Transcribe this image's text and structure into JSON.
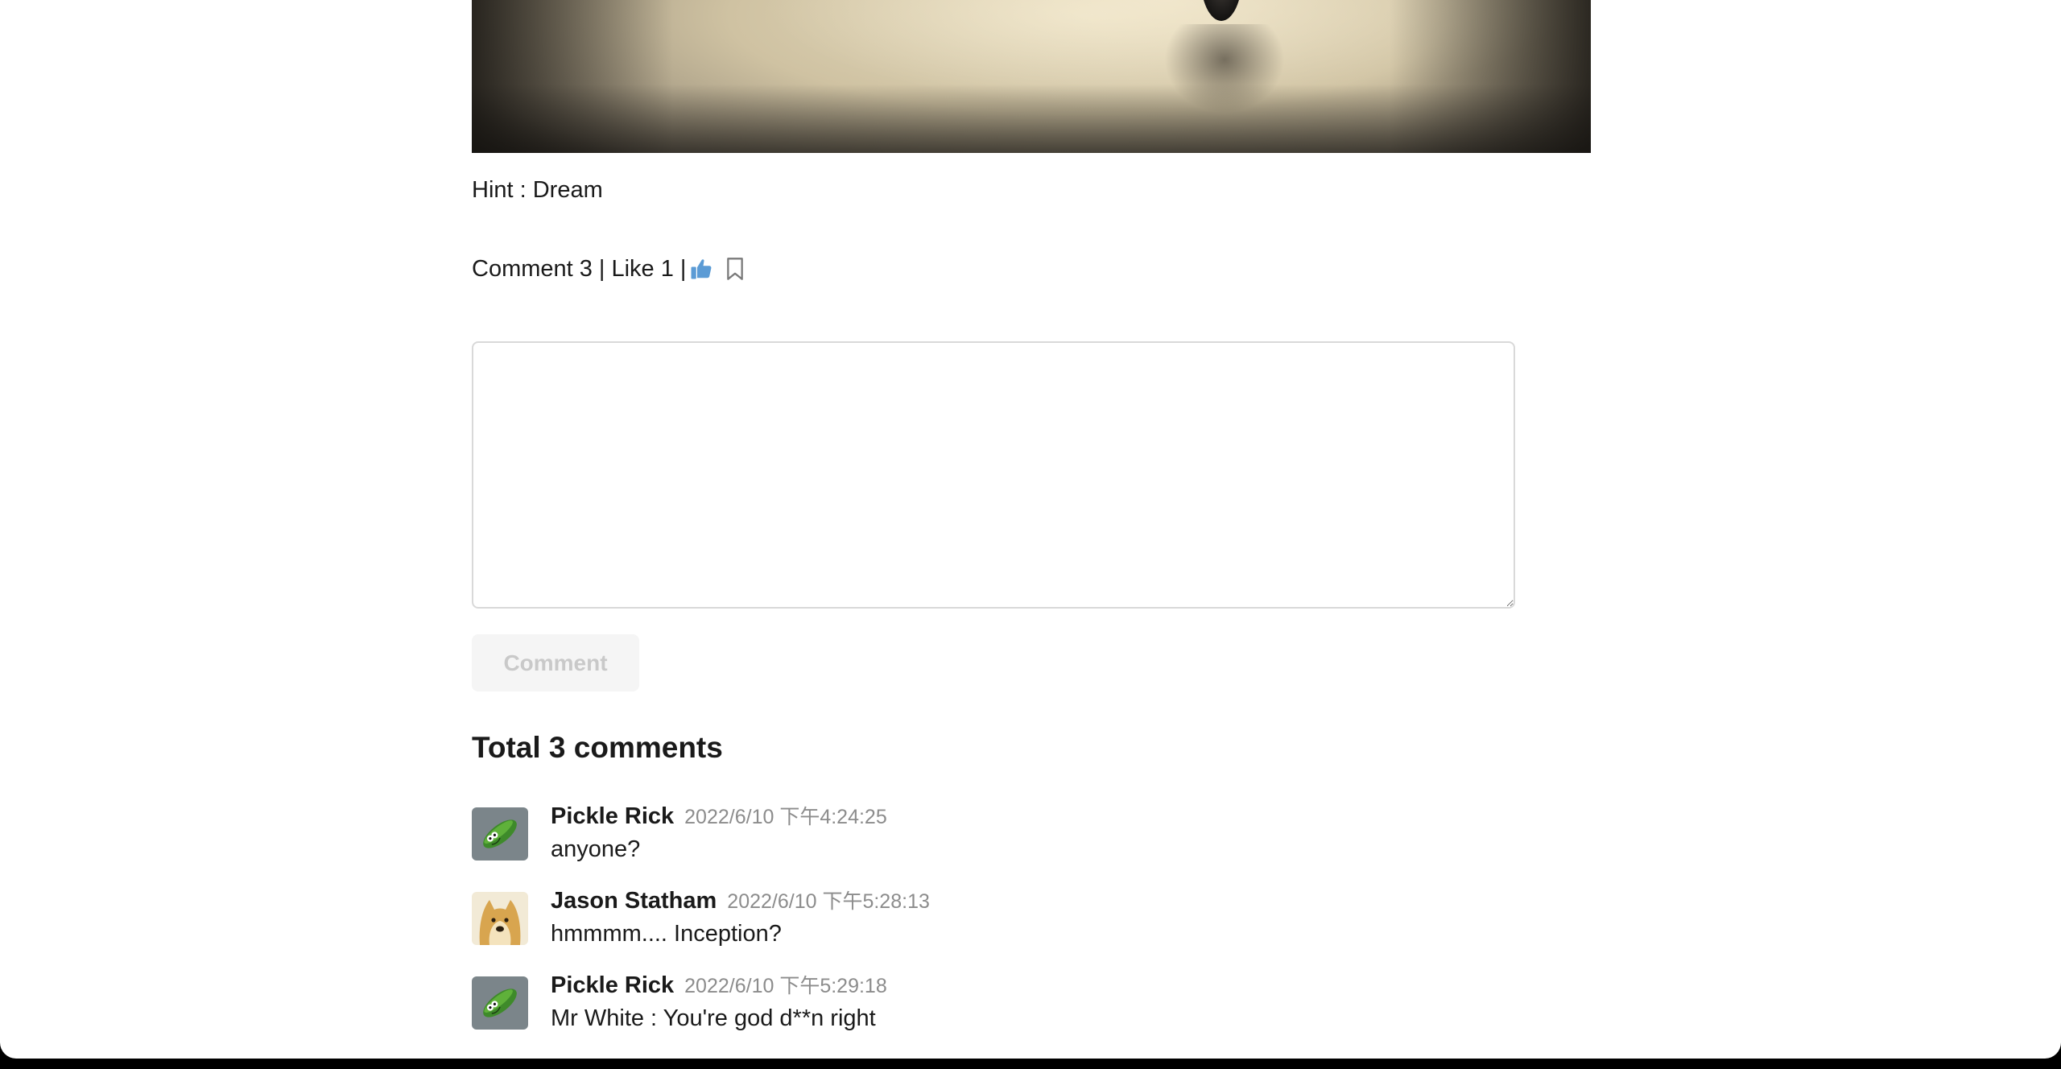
{
  "post": {
    "hint": "Hint : Dream"
  },
  "stats": {
    "comment_label": "Comment 3",
    "separator": "|",
    "like_label": "Like 1",
    "like_color": "#5b9bd5"
  },
  "composer": {
    "placeholder": "",
    "value": "",
    "submit_label": "Comment"
  },
  "comments_section": {
    "total_label": "Total 3 comments",
    "items": [
      {
        "author": "Pickle Rick",
        "time": "2022/6/10 下午4:24:25",
        "text": "anyone?",
        "avatar": "pickle-avatar"
      },
      {
        "author": "Jason Statham",
        "time": "2022/6/10 下午5:28:13",
        "text": "hmmmm.... Inception?",
        "avatar": "doge-avatar"
      },
      {
        "author": "Pickle Rick",
        "time": "2022/6/10 下午5:29:18",
        "text": "Mr White : You're god d**n right",
        "avatar": "pickle-avatar"
      }
    ]
  },
  "icons": {
    "like": "thumbs-up-icon",
    "bookmark": "bookmark-icon"
  }
}
